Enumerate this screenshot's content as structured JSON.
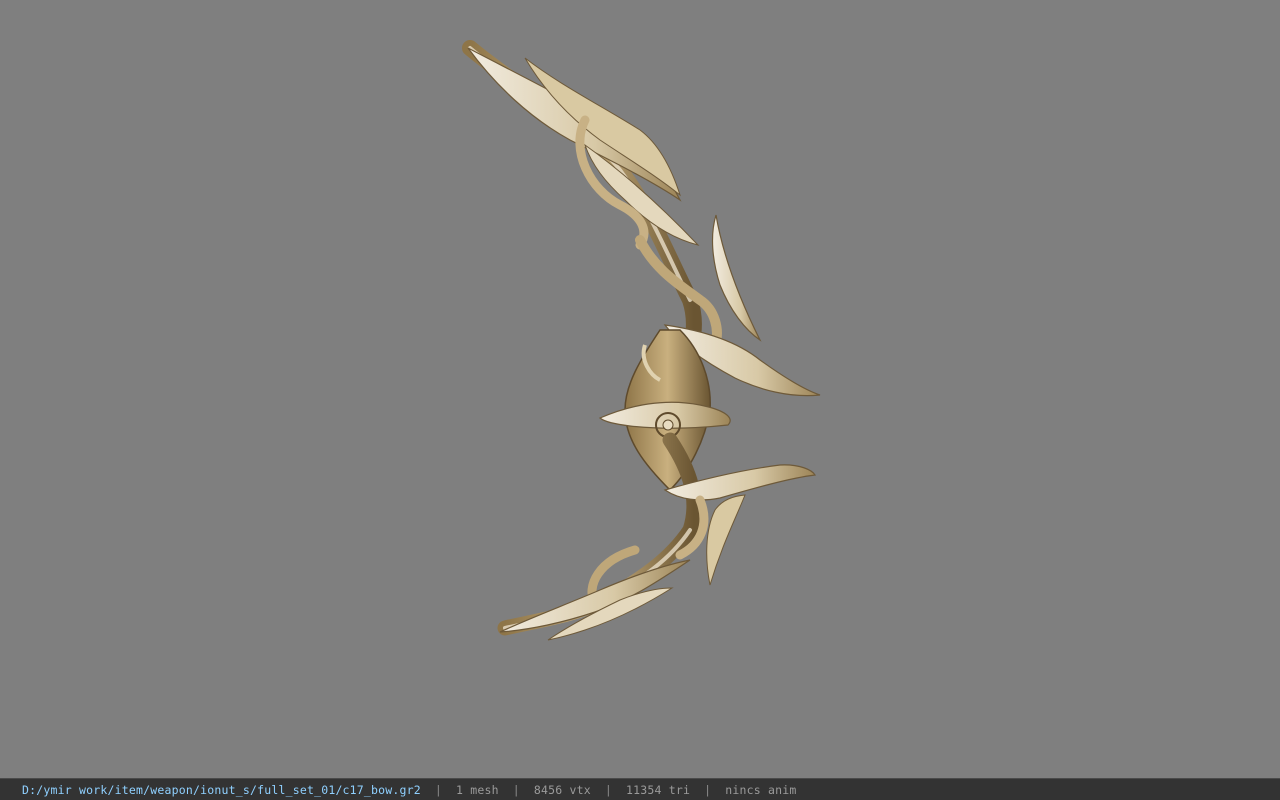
{
  "viewport": {
    "background": "#7f7f7f",
    "model_name": "bow-model"
  },
  "status_bar": {
    "file_path": "D:/ymir work/item/weapon/ionut_s/full_set_01/c17_bow.gr2",
    "separator": "|",
    "mesh_count": "1 mesh",
    "vertex_count": "8456 vtx",
    "triangle_count": "11354 tri",
    "anim_status": "nincs anim"
  },
  "colors": {
    "path_text": "#8fd0ff",
    "stat_text": "#9a9a9a",
    "bar_bg": "#333333",
    "bow_gold": "#b39a6b",
    "bow_light": "#e6dcc4",
    "bow_dark": "#6e5a3a"
  }
}
